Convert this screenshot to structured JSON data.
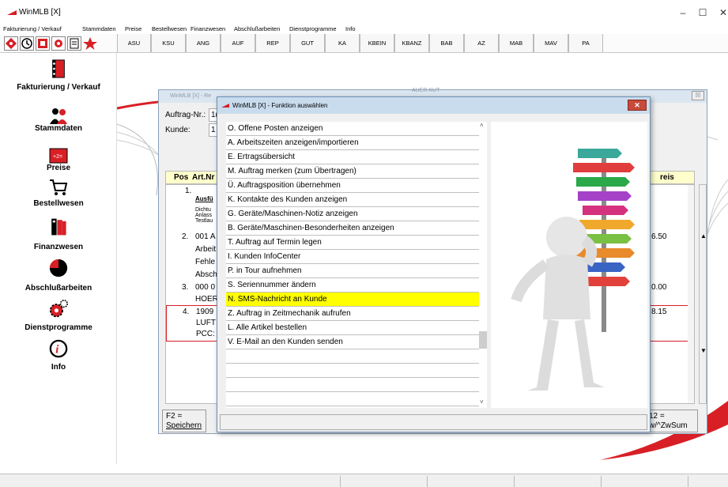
{
  "window": {
    "title": "WinMLB [X]",
    "controls": {
      "minimize": "–",
      "maximize": "☐",
      "close": "✕"
    }
  },
  "menu": [
    "Fakturierung / Verkauf",
    "Stammdaten",
    "Preise",
    "Bestellwesen",
    "Finanzwesen",
    "Abschlußarbeiten",
    "Dienstprogramme",
    "Info"
  ],
  "toolbar": {
    "tabs": [
      "ASU",
      "KSU",
      "ANG",
      "AUF",
      "REP",
      "GUT",
      "KA",
      "KBEIN",
      "KBANZ",
      "BAB",
      "AZ",
      "MAB",
      "MAV",
      "PA"
    ]
  },
  "sidebar": {
    "items": [
      {
        "label": "Fakturierung / Verkauf",
        "icon": "binder-icon"
      },
      {
        "label": "Stammdaten",
        "icon": "people-icon"
      },
      {
        "label": "Preise",
        "icon": "calculator-icon"
      },
      {
        "label": "Bestellwesen",
        "icon": "cart-icon"
      },
      {
        "label": "Finanzwesen",
        "icon": "folders-icon"
      },
      {
        "label": "Abschlußarbeiten",
        "icon": "pie-chart-icon"
      },
      {
        "label": "Dienstprogramme",
        "icon": "gears-icon"
      },
      {
        "label": "Info",
        "icon": "info-icon"
      }
    ]
  },
  "order_window": {
    "title": "WinMLB [X] - Re",
    "title_tail": "AUER KUT",
    "auftrag_label": "Auftrag-Nr.:",
    "auftrag_value": "1(",
    "kunde_label": "Kunde:",
    "kunde_value": "1",
    "grid": {
      "headers": [
        "Pos",
        "Art.Nr",
        "reis"
      ],
      "rows": [
        {
          "pos": "1.",
          "lines": [
            "Ausfü",
            "Dichtu",
            "Anlass",
            "Testlau"
          ],
          "price": ""
        },
        {
          "pos": "2.",
          "lines": [
            "001 A",
            "Arbeit",
            "Fehle",
            "Absch"
          ],
          "price": "6.50"
        },
        {
          "pos": "3.",
          "lines": [
            "000 0",
            "HOER"
          ],
          "price": "0.00"
        },
        {
          "pos": "4.",
          "lines": [
            "1909",
            "LUFT",
            "PCC:"
          ],
          "price": "8.15"
        }
      ]
    },
    "buttons": {
      "f2": "F2 =",
      "f2_sub": "Speichern",
      "f12": "12 =",
      "f12_sub": "w/^ZwSum"
    }
  },
  "dialog": {
    "title": "WinMLB [X] -  Funktion auswählen",
    "close": "✕",
    "selected_index": 12,
    "items": [
      "O. Offene Posten anzeigen",
      "A. Arbeitszeiten anzeigen/importieren",
      "E. Ertragsübersicht",
      "M. Auftrag merken (zum Übertragen)",
      "Ü. Auftragsposition übernehmen",
      "K. Kontakte des Kunden anzeigen",
      "G. Geräte/Maschinen-Notiz anzeigen",
      "B. Geräte/Maschinen-Besonderheiten anzeigen",
      "T. Auftrag auf Termin legen",
      "I. Kunden InfoCenter",
      "P. in Tour aufnehmen",
      "S. Seriennummer ändern",
      "N. SMS-Nachricht an Kunde",
      "Z. Auftrag in Zeitmechanik aufrufen",
      "L. Alle Artikel bestellen",
      "V. E-Mail an den Kunden senden",
      "",
      "",
      "",
      ""
    ]
  },
  "colors": {
    "accent": "#d81f26",
    "selected": "#ffff00",
    "grid_header": "#ffffcc"
  }
}
